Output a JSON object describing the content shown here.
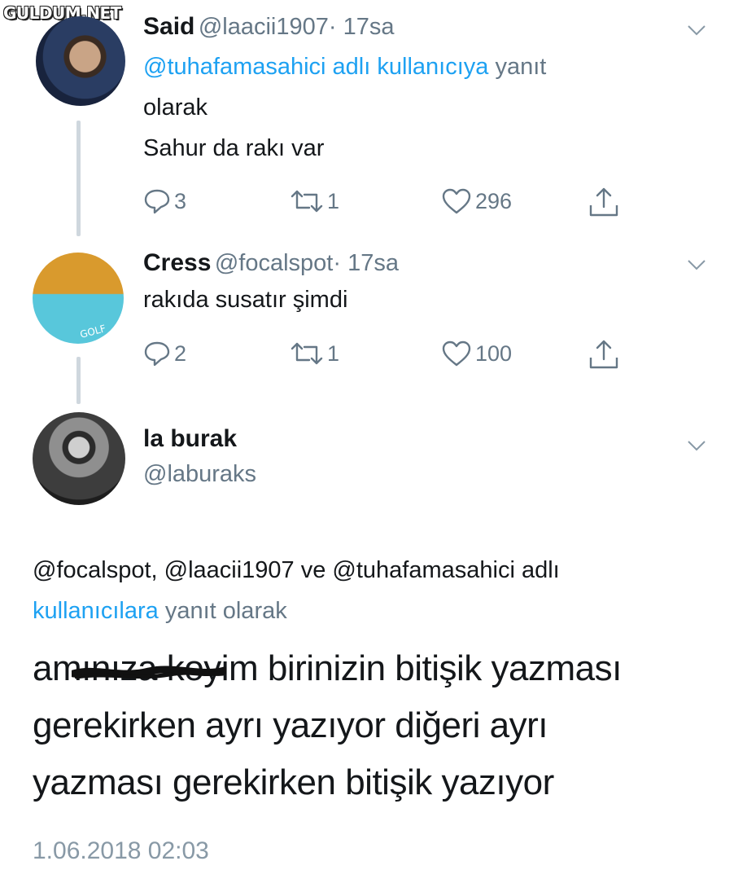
{
  "watermark": "GULDUM.NET",
  "tweets": [
    {
      "name": "Said",
      "handle": "@laacii1907",
      "time": "· 17sa",
      "reply_to_link": "@tuhafamasahici adlı kullanıcıya",
      "reply_to_suffix": "yanıt",
      "reply_to_line2": "olarak",
      "text": "Sahur da rakı var",
      "replies": "3",
      "retweets": "1",
      "likes": "296"
    },
    {
      "name": "Cress",
      "handle": "@focalspot",
      "time": "· 17sa",
      "text": "rakıda susatır şimdi",
      "replies": "2",
      "retweets": "1",
      "likes": "100"
    }
  ],
  "main_tweet": {
    "name": "la burak",
    "handle": "@laburaks",
    "reply_line1_link": "@focalspot, @laacii1907 ve @tuhafamasahici adlı",
    "reply_line2_link": "kullanıcılara",
    "reply_line2_suffix": "yanıt olarak",
    "line1_start": "amınıza koyim",
    "line1_rest": "birinizin bitişik yazması",
    "line2": "gerekirken ayrı yazıyor diğeri ayrı",
    "line3": "yazması gerekirken bitişik yazıyor",
    "timestamp": "1.06.2018 02:03"
  },
  "icons": [
    "reply-icon",
    "retweet-icon",
    "like-icon",
    "share-icon",
    "chevron-down-icon"
  ],
  "colors": {
    "link": "#1da1f2",
    "secondary": "#657786",
    "text": "#14171a",
    "thread": "#cfd7de"
  }
}
